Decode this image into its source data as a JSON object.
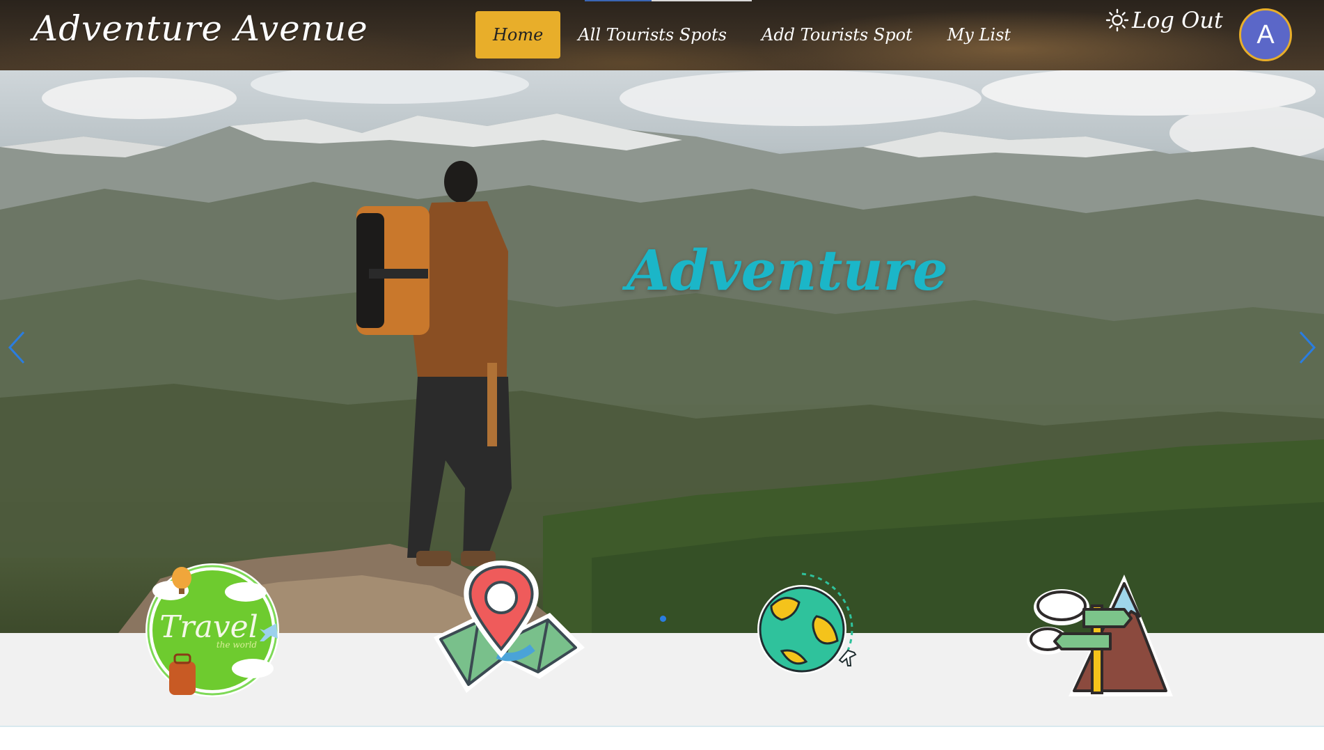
{
  "navbar": {
    "brand": "Adventure Avenue",
    "links": [
      {
        "label": "Home",
        "active": true
      },
      {
        "label": "All Tourists Spots",
        "active": false
      },
      {
        "label": "Add Tourists Spot",
        "active": false
      },
      {
        "label": "My List",
        "active": false
      }
    ],
    "theme_icon": "sun-icon",
    "logout_label": "Log Out",
    "avatar_initial": "A",
    "accent_color": "#e8ae2a"
  },
  "hero": {
    "title": "Adventure",
    "title_color": "#1bb6c8",
    "prev_icon": "chevron-left-icon",
    "next_icon": "chevron-right-icon"
  },
  "feature_icons": [
    {
      "name": "travel-badge-icon",
      "text": "Travel",
      "subtext": "the world"
    },
    {
      "name": "map-pin-icon"
    },
    {
      "name": "globe-plane-icon"
    },
    {
      "name": "signpost-mountain-icon"
    }
  ]
}
